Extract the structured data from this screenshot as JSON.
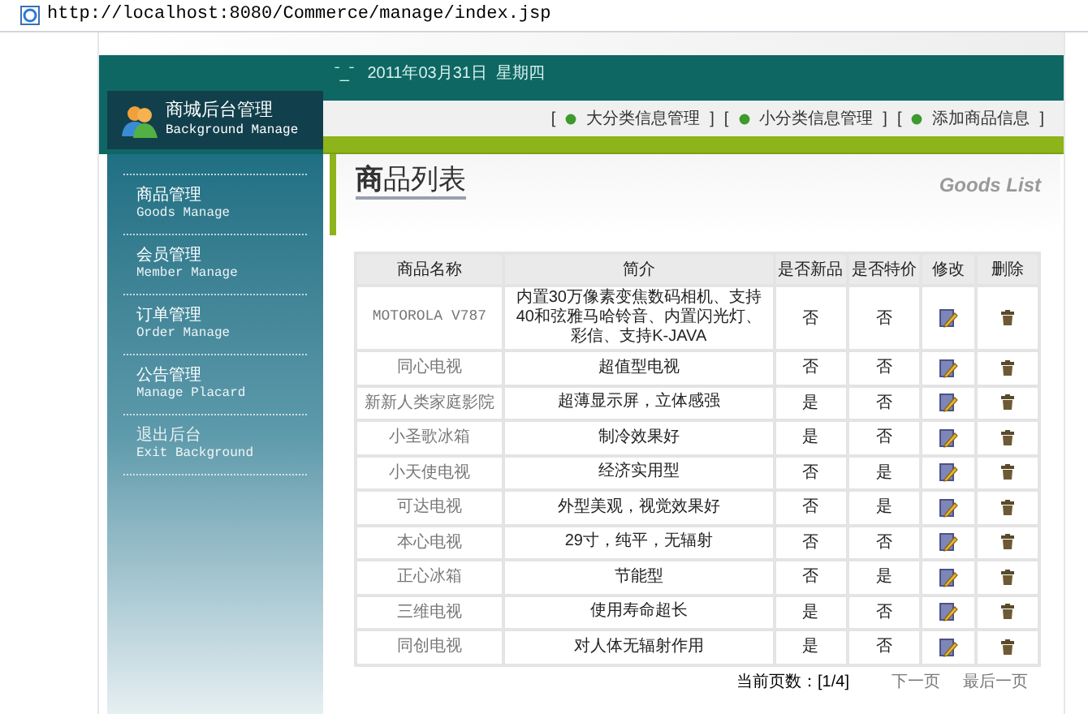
{
  "address_bar": {
    "url": "http://localhost:8080/Commerce/manage/index.jsp"
  },
  "header": {
    "emoticon": "ˉ_ˉ",
    "date": "2011年03月31日  星期四"
  },
  "logo": {
    "title": "商城后台管理",
    "subtitle": "Background Manage"
  },
  "nav_links": [
    {
      "open": "[",
      "label": "大分类信息管理",
      "close": "]"
    },
    {
      "open": "[",
      "label": "小分类信息管理",
      "close": "]"
    },
    {
      "open": "[",
      "label": "添加商品信息",
      "close": "]"
    }
  ],
  "sidebar": {
    "items": [
      {
        "title": "商品管理",
        "subtitle": "Goods Manage"
      },
      {
        "title": "会员管理",
        "subtitle": "Member Manage"
      },
      {
        "title": "订单管理",
        "subtitle": "Order Manage"
      },
      {
        "title": "公告管理",
        "subtitle": "Manage Placard"
      },
      {
        "title": "退出后台",
        "subtitle": "Exit Background"
      }
    ]
  },
  "content": {
    "title": "**商**品列表",
    "title_en": "Goods List"
  },
  "table": {
    "columns": [
      "商品名称",
      "简介",
      "是否新品",
      "是否特价",
      "修改",
      "删除"
    ],
    "rows": [
      {
        "name": "MOTOROLA V787",
        "intro": "内置30万像素变焦数码相机、支持40和弦雅马哈铃音、内置闪光灯、彩信、支持K-JAVA",
        "is_new": "否",
        "is_special": "否"
      },
      {
        "name": "同心电视",
        "intro": "超值型电视",
        "is_new": "否",
        "is_special": "否"
      },
      {
        "name": "新新人类家庭影院",
        "intro": "超薄显示屏，立体感强",
        "is_new": "是",
        "is_special": "否"
      },
      {
        "name": "小圣歌冰箱",
        "intro": "制冷效果好",
        "is_new": "是",
        "is_special": "否"
      },
      {
        "name": "小天使电视",
        "intro": "经济实用型",
        "is_new": "否",
        "is_special": "是"
      },
      {
        "name": "可达电视",
        "intro": "外型美观，视觉效果好",
        "is_new": "否",
        "is_special": "是"
      },
      {
        "name": "本心电视",
        "intro": "29寸，纯平，无辐射",
        "is_new": "否",
        "is_special": "否"
      },
      {
        "name": "正心冰箱",
        "intro": "节能型",
        "is_new": "否",
        "is_special": "是"
      },
      {
        "name": "三维电视",
        "intro": "使用寿命超长",
        "is_new": "是",
        "is_special": "否"
      },
      {
        "name": "同创电视",
        "intro": "对人体无辐射作用",
        "is_new": "是",
        "is_special": "否"
      }
    ]
  },
  "pager": {
    "current": "当前页数：[1/4]",
    "next": "下一页",
    "last": "最后一页"
  }
}
